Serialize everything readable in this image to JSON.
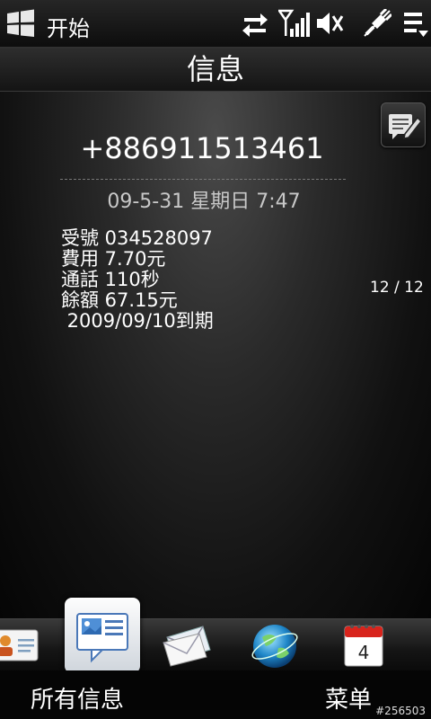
{
  "statusbar": {
    "start_label": "开始",
    "icons": [
      "windows-start-icon",
      "data-sync-icon",
      "signal-icon",
      "speaker-muted-icon",
      "power-plug-icon",
      "menu-dropdown-icon"
    ]
  },
  "titlebar": {
    "title": "信息"
  },
  "message": {
    "sender": "+886911513461",
    "timestamp": "09-5-31 星期日 7:47",
    "lines": [
      "受號 034528097",
      "費用 7.70元",
      "通話 110秒",
      "餘額 67.15元",
      " 2009/09/10到期"
    ],
    "counter": "12 / 12"
  },
  "dock": {
    "items": [
      "contacts-icon",
      "all-messages-icon",
      "email-icon",
      "internet-globe-icon",
      "calendar-icon"
    ],
    "calendar_day": "4"
  },
  "softkeys": {
    "left": "所有信息",
    "right": "菜单"
  },
  "watermark": "#256503"
}
